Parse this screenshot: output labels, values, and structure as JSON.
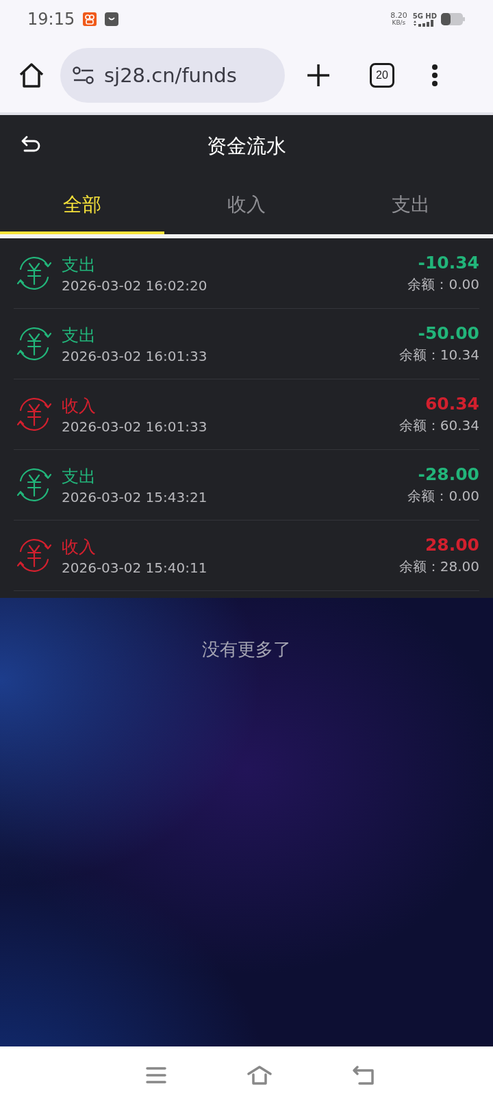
{
  "status_bar": {
    "time": "19:15",
    "net_speed": "8.20",
    "net_unit": "KB/s",
    "network": "5G HD"
  },
  "browser": {
    "url": "sj28.cn/funds",
    "tab_count": "20"
  },
  "header": {
    "title": "资金流水"
  },
  "tabs": [
    {
      "label": "全部",
      "selected": true
    },
    {
      "label": "收入",
      "selected": false
    },
    {
      "label": "支出",
      "selected": false
    }
  ],
  "transactions": [
    {
      "kind": "expense",
      "label": "支出",
      "time": "2026-03-02 16:02:20",
      "amount": "-10.34",
      "balance": "余额：0.00"
    },
    {
      "kind": "expense",
      "label": "支出",
      "time": "2026-03-02 16:01:33",
      "amount": "-50.00",
      "balance": "余额：10.34"
    },
    {
      "kind": "income",
      "label": "收入",
      "time": "2026-03-02 16:01:33",
      "amount": "60.34",
      "balance": "余额：60.34"
    },
    {
      "kind": "expense",
      "label": "支出",
      "time": "2026-03-02 15:43:21",
      "amount": "-28.00",
      "balance": "余额：0.00"
    },
    {
      "kind": "income",
      "label": "收入",
      "time": "2026-03-02 15:40:11",
      "amount": "28.00",
      "balance": "余额：28.00"
    }
  ],
  "end_note": "没有更多了"
}
